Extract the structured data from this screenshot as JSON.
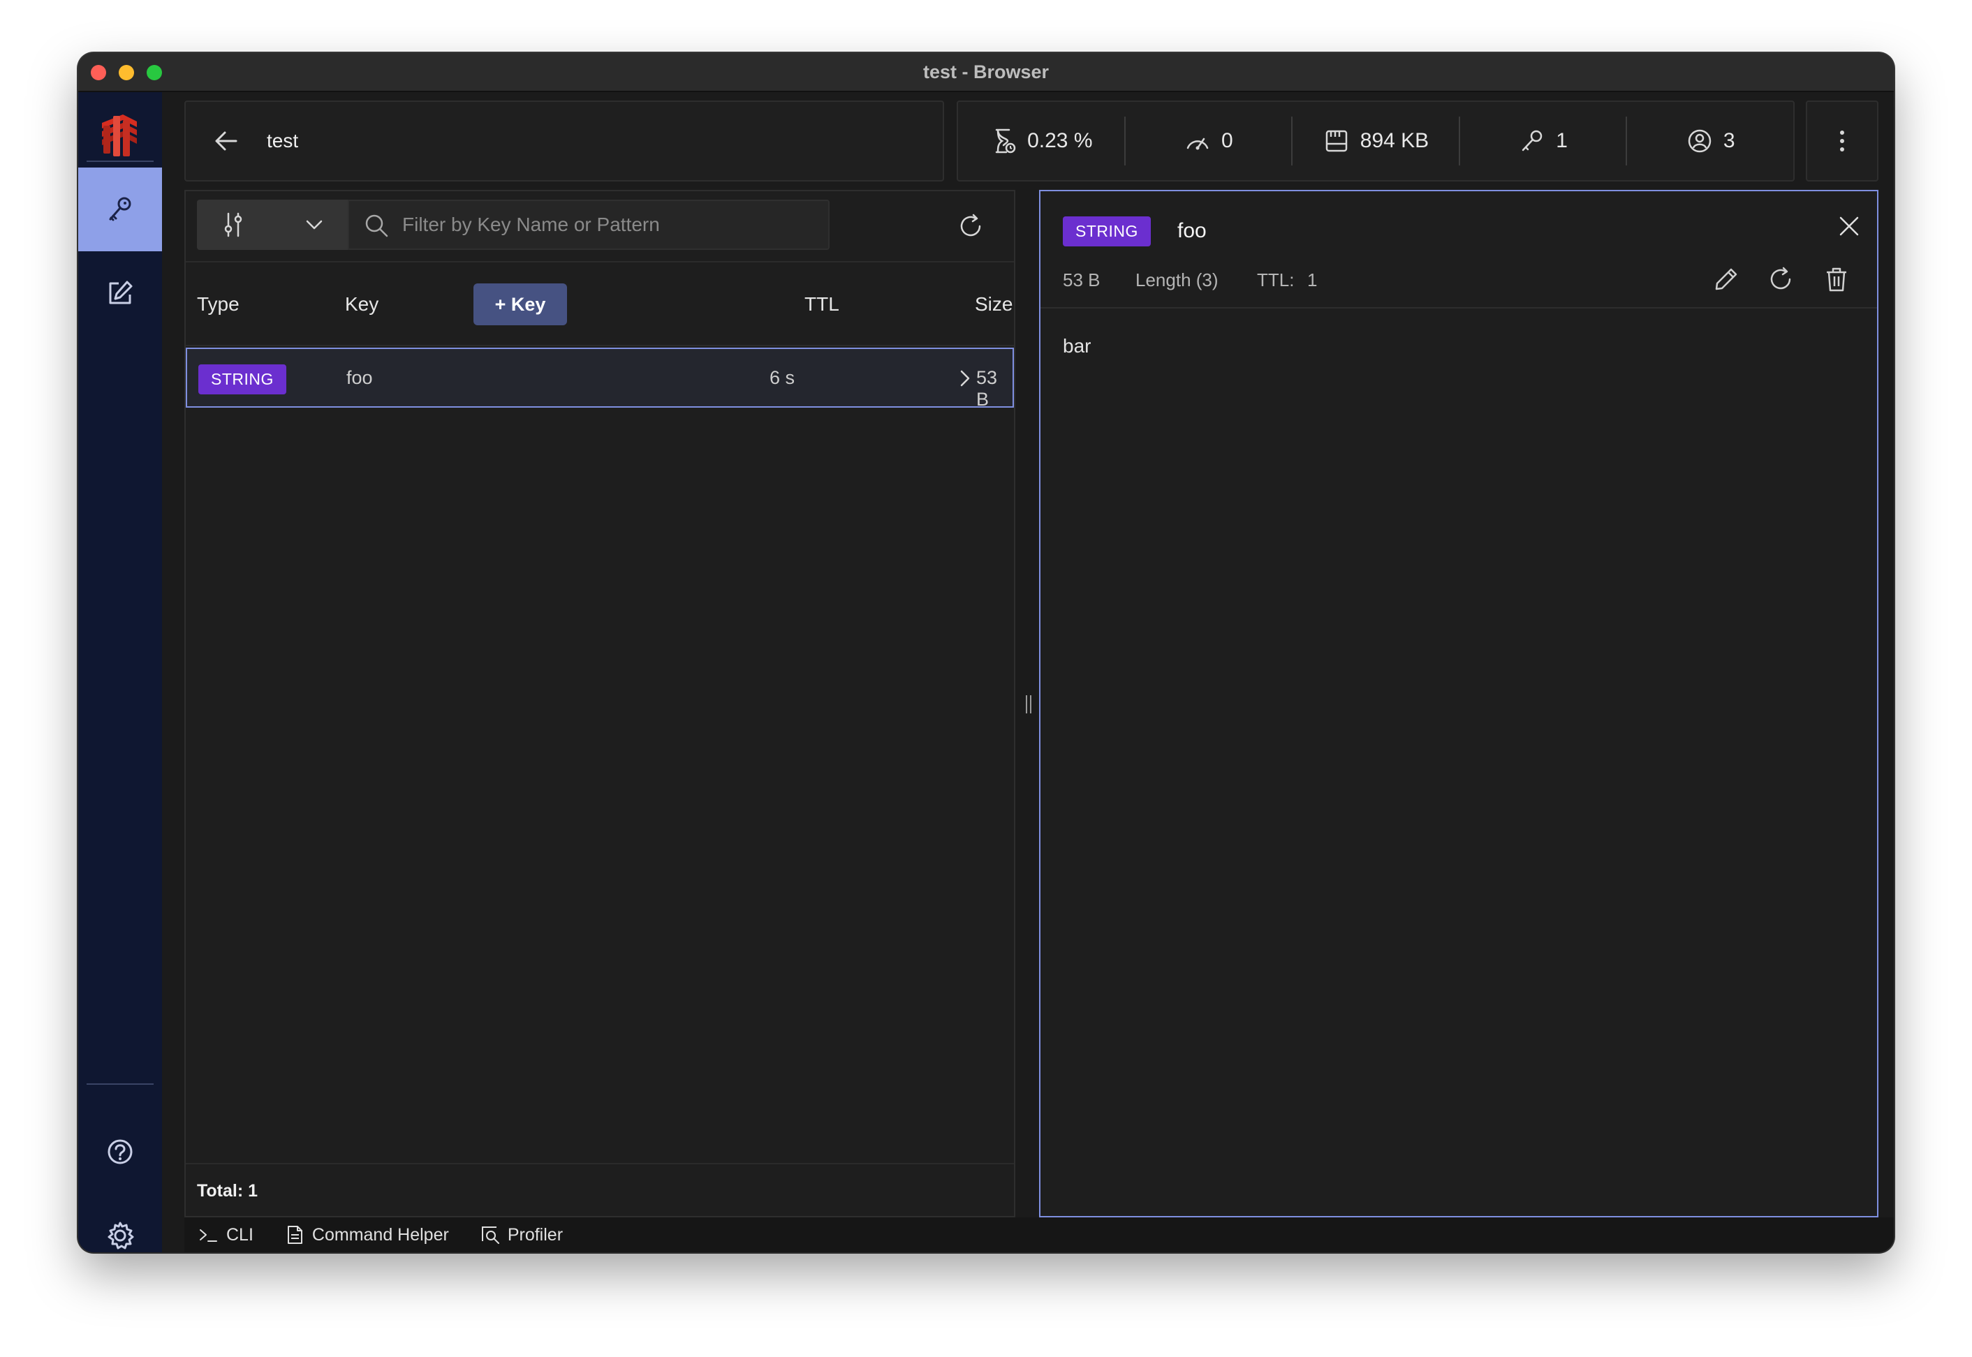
{
  "window": {
    "title": "test - Browser"
  },
  "topbar": {
    "db_name": "test",
    "stats": {
      "cpu": "0.23 %",
      "ops": "0",
      "memory": "894 KB",
      "keys": "1",
      "clients": "3"
    }
  },
  "filter": {
    "placeholder": "Filter by Key Name or Pattern"
  },
  "table": {
    "headers": {
      "type": "Type",
      "key": "Key",
      "ttl": "TTL",
      "size": "Size"
    },
    "add_key_label": "+ Key",
    "rows": [
      {
        "type": "STRING",
        "key": "foo",
        "ttl": "6 s",
        "size": "53 B"
      }
    ],
    "total": "Total: 1"
  },
  "detail": {
    "type": "STRING",
    "key": "foo",
    "size": "53 B",
    "length": "Length (3)",
    "ttl_label": "TTL:",
    "ttl_value": "1",
    "value": "bar"
  },
  "bottombar": {
    "cli": "CLI",
    "command_helper": "Command Helper",
    "profiler": "Profiler"
  },
  "colors": {
    "accent": "#8ea0e8",
    "string_badge": "#6b2fcf",
    "add_key_button": "#465282",
    "sidebar": "#0f1731",
    "logo": "#d62d20"
  }
}
